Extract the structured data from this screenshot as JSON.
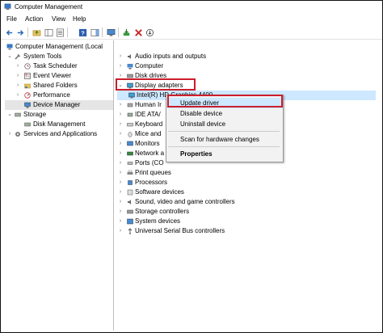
{
  "window": {
    "title": "Computer Management"
  },
  "menu": {
    "file": "File",
    "action": "Action",
    "view": "View",
    "help": "Help"
  },
  "toolbar_icons": [
    "back-arrow-icon",
    "forward-arrow-icon",
    "up-folder-icon",
    "show-hide-tree-icon",
    "properties-icon",
    "help-icon",
    "computer-icon",
    "update-driver-icon",
    "uninstall-icon",
    "scan-hardware-icon"
  ],
  "left_tree": {
    "root": "Computer Management (Local",
    "system_tools": "System Tools",
    "task_scheduler": "Task Scheduler",
    "event_viewer": "Event Viewer",
    "shared_folders": "Shared Folders",
    "performance": "Performance",
    "device_manager": "Device Manager",
    "storage": "Storage",
    "disk_management": "Disk Management",
    "services_apps": "Services and Applications"
  },
  "devices": {
    "audio": "Audio inputs and outputs",
    "computer": "Computer",
    "disk_drives": "Disk drives",
    "display_adapters": "Display adapters",
    "intel_gpu": "Intel(R) HD Graphics 4400",
    "human": "Human Ir",
    "ide": "IDE ATA/",
    "keyboards": "Keyboard",
    "mice": "Mice and",
    "monitors": "Monitors",
    "network": "Network a",
    "ports": "Ports (CO",
    "print_queues": "Print queues",
    "processors": "Processors",
    "software_devices": "Software devices",
    "sound": "Sound, video and game controllers",
    "storage_controllers": "Storage controllers",
    "system_devices": "System devices",
    "usb": "Universal Serial Bus controllers"
  },
  "context_menu": {
    "update_driver": "Update driver",
    "disable_device": "Disable device",
    "uninstall_device": "Uninstall device",
    "scan_hardware": "Scan for hardware changes",
    "properties": "Properties"
  },
  "colors": {
    "highlight": "#cc1e2c",
    "selection": "#cde8ff",
    "menu_bg": "#f2f2f2"
  }
}
